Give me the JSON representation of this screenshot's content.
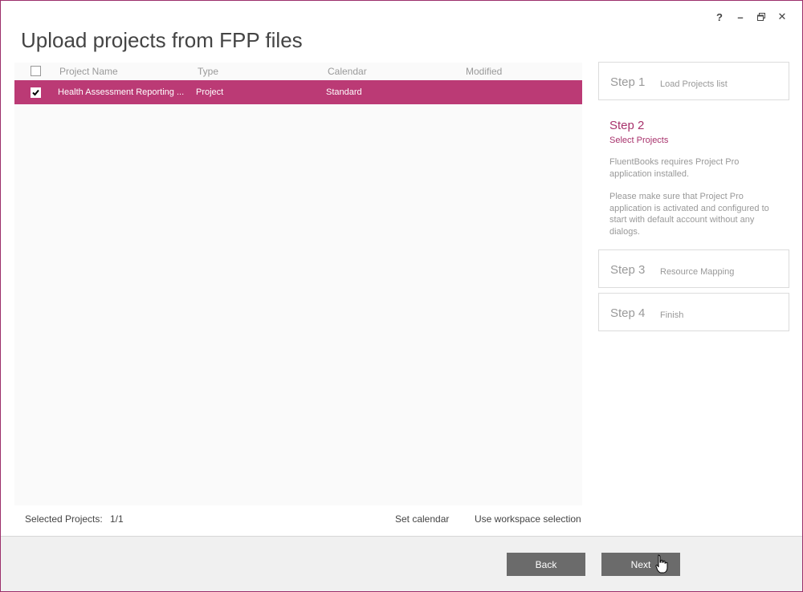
{
  "window": {
    "controls": {
      "help": "?",
      "minimize": "–",
      "restore": "🗗",
      "close": "✕"
    }
  },
  "page": {
    "title": "Upload projects from FPP files"
  },
  "grid": {
    "columns": [
      "Project Name",
      "Type",
      "Calendar",
      "Modified"
    ],
    "rows": [
      {
        "checked": true,
        "name": "Health Assessment Reporting ...",
        "type": "Project",
        "calendar": "Standard",
        "modified": ""
      }
    ]
  },
  "steps": {
    "step1": {
      "num": "Step 1",
      "label": "Load Projects list"
    },
    "step2": {
      "num": "Step 2",
      "label": "Select Projects",
      "text1": "FluentBooks requires Project Pro application installed.",
      "text2": "Please make sure that Project Pro application is activated and configured to start with default account without any dialogs."
    },
    "step3": {
      "num": "Step 3",
      "label": "Resource Mapping"
    },
    "step4": {
      "num": "Step 4",
      "label": "Finish"
    }
  },
  "info": {
    "selected_label": "Selected Projects:",
    "selected_value": "1/1",
    "set_calendar": "Set calendar",
    "use_workspace": "Use workspace selection"
  },
  "footer": {
    "back": "Back",
    "next": "Next"
  },
  "colors": {
    "accent": "#bb3a75",
    "step_active": "#a8326c",
    "button": "#6b6b6b"
  }
}
